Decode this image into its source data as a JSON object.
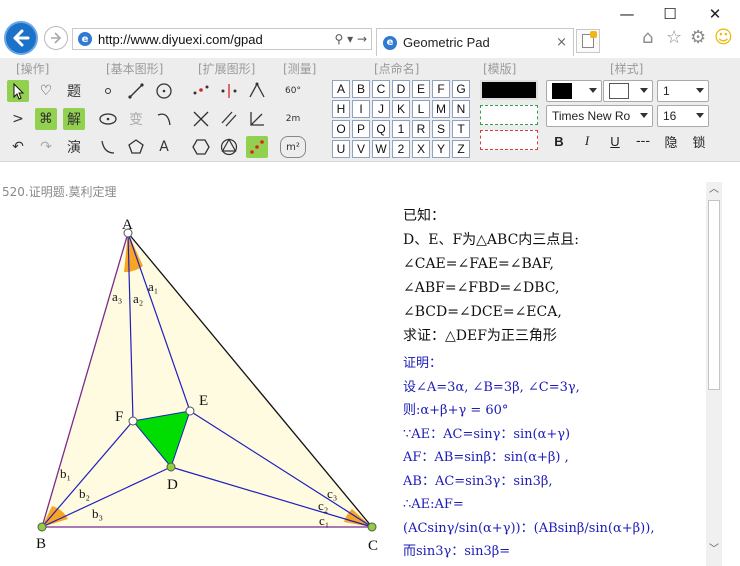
{
  "browser": {
    "url": "http://www.diyuexi.com/gpad",
    "tab_title": "Geometric Pad",
    "minimize": "—",
    "maximize": "☐",
    "close": "✕",
    "back_icon": "back-arrow-icon",
    "forward_icon": "forward-arrow-icon",
    "tab_close": "×",
    "addr_actions": "⚲ ▾ →",
    "home": "⌂",
    "favorites": "☆",
    "settings": "⚙",
    "feedback": "☺"
  },
  "toolbar": {
    "groups": {
      "ops": "[操作]",
      "basic": "[基本图形]",
      "ext": "[扩展图形]",
      "measure": "[测量]",
      "point_name": "[点命名]",
      "template": "[模版]",
      "style": "[样式]"
    },
    "ops": {
      "heart": "♡",
      "title": "题",
      "next": ">",
      "cmd": "⌘",
      "solve": "解",
      "undo": "↶",
      "redo": "↷",
      "demo": "演"
    },
    "basic": {
      "transform": "变",
      "text": "A"
    },
    "measure": {
      "angle": "60°",
      "length": "2m",
      "area": "m²"
    },
    "letters": [
      "A",
      "B",
      "C",
      "D",
      "E",
      "F",
      "G",
      "H",
      "I",
      "J",
      "K",
      "L",
      "M",
      "N",
      "O",
      "P",
      "Q",
      "1",
      "R",
      "S",
      "T",
      "U",
      "V",
      "W",
      "2",
      "X",
      "Y",
      "Z"
    ],
    "style": {
      "line_width": "1",
      "font_name": "Times New Ro",
      "font_size": "16",
      "bold": "B",
      "italic": "I",
      "underline": "U",
      "dash": "---",
      "hide": "隐",
      "lock": "锁"
    }
  },
  "content": {
    "breadcrumb": "520.证明题.莫利定理",
    "given": [
      "已知：",
      "D、E、F为△ABC内三点且:",
      "∠CAE=∠FAE=∠BAF,",
      "∠ABF=∠FBD=∠DBC,",
      "∠BCD=∠DCE=∠ECA,",
      "求证：△DEF为正三角形"
    ],
    "proof": [
      "证明：",
      "设∠A=3α, ∠B=3β, ∠C=3γ,",
      "则:α+β+γ = 60°",
      "∵AE：AC=sinγ：sin(α+γ)",
      "AF：AB=sinβ：sin(α+β) ,",
      "AB：AC=sin3γ：sin3β,",
      "∴AE:AF=",
      "(ACsinγ/sin(α+γ))：(ABsinβ/sin(α+β)),",
      "而sin3γ：sin3β="
    ]
  },
  "figure": {
    "points": [
      {
        "name": "A",
        "label": "A"
      },
      {
        "name": "B",
        "label": "B"
      },
      {
        "name": "C",
        "label": "C"
      },
      {
        "name": "D",
        "label": "D"
      },
      {
        "name": "E",
        "label": "E"
      },
      {
        "name": "F",
        "label": "F"
      }
    ],
    "angle_labels": [
      "a₁",
      "a₂",
      "a₃",
      "b₁",
      "b₂",
      "b₃",
      "c₁",
      "c₂",
      "c₃"
    ],
    "colors": {
      "triangle_fill": "#fffbe1",
      "inner_fill": "#00dd00",
      "construction_line": "#1f1fbf",
      "side_line": "#111111",
      "angle_fill": "#f7a623",
      "point": "#8fcf3f"
    }
  }
}
